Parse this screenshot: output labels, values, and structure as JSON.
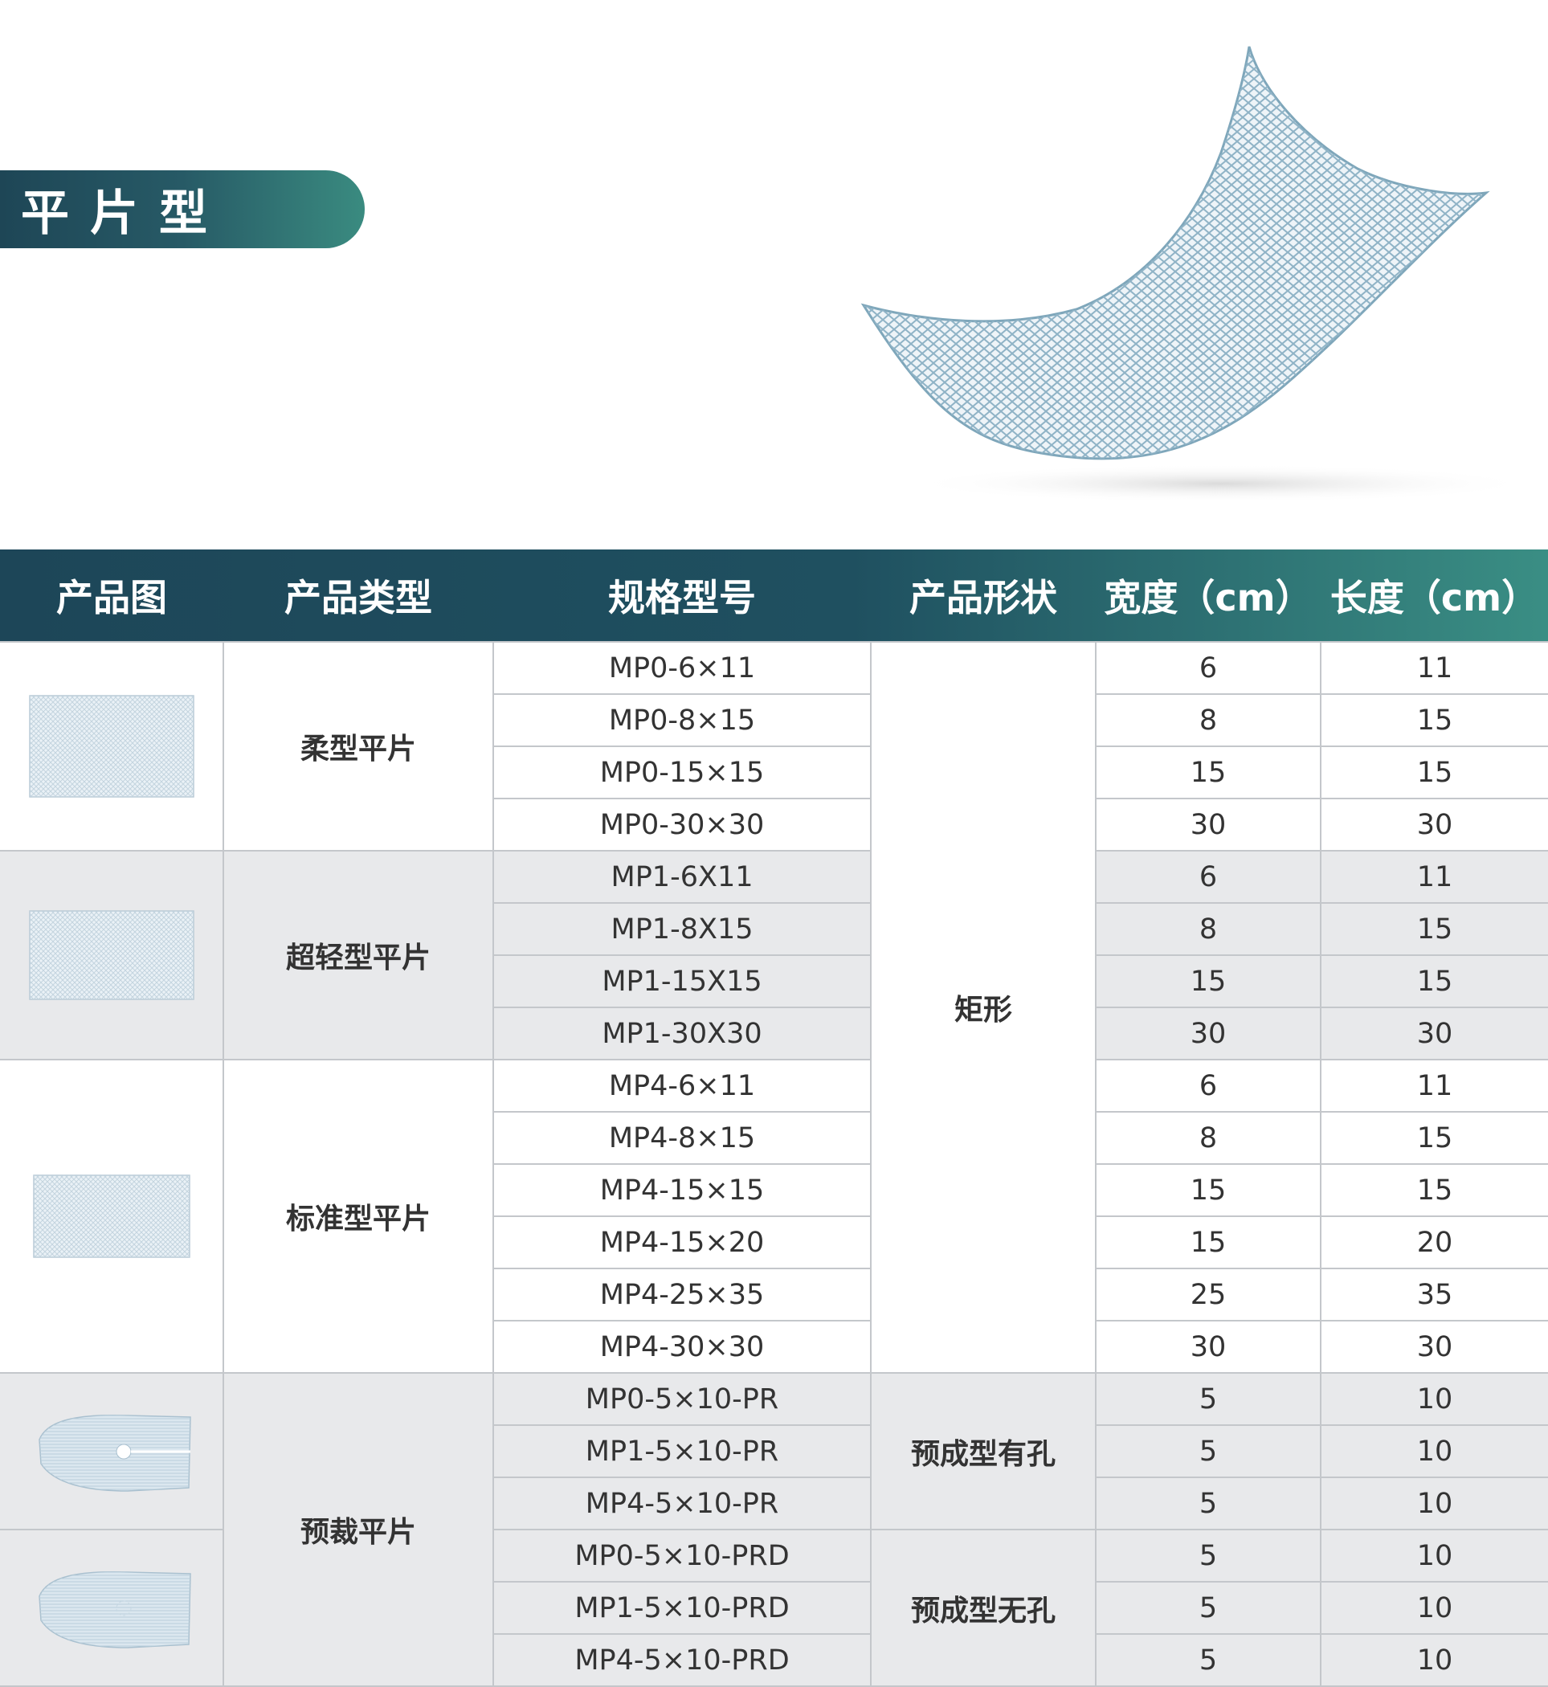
{
  "section": {
    "title": "平片型"
  },
  "icons": {
    "hero": "mesh-sheet-illustration"
  },
  "colors": {
    "header_dark": "#1d4658",
    "header_light": "#3a8e84",
    "row_grey": "#e8e9eb"
  },
  "table": {
    "headers": [
      "产品图",
      "产品类型",
      "规格型号",
      "产品形状",
      "宽度（cm）",
      "长度（cm）"
    ],
    "groups": [
      {
        "type": "柔型平片",
        "image": "rectangular-mesh-thumb",
        "rows": [
          {
            "model": "MP0-6×11",
            "width": "6",
            "length": "11"
          },
          {
            "model": "MP0-8×15",
            "width": "8",
            "length": "15"
          },
          {
            "model": "MP0-15×15",
            "width": "15",
            "length": "15"
          },
          {
            "model": "MP0-30×30",
            "width": "30",
            "length": "30"
          }
        ]
      },
      {
        "type": "超轻型平片",
        "image": "rectangular-mesh-thumb",
        "rows": [
          {
            "model": "MP1-6X11",
            "width": "6",
            "length": "11"
          },
          {
            "model": "MP1-8X15",
            "width": "8",
            "length": "15"
          },
          {
            "model": "MP1-15X15",
            "width": "15",
            "length": "15"
          },
          {
            "model": "MP1-30X30",
            "width": "30",
            "length": "30"
          }
        ]
      },
      {
        "type": "标准型平片",
        "image": "rectangular-mesh-thumb",
        "rows": [
          {
            "model": "MP4-6×11",
            "width": "6",
            "length": "11"
          },
          {
            "model": "MP4-8×15",
            "width": "8",
            "length": "15"
          },
          {
            "model": "MP4-15×15",
            "width": "15",
            "length": "15"
          },
          {
            "model": "MP4-15×20",
            "width": "15",
            "length": "20"
          },
          {
            "model": "MP4-25×35",
            "width": "25",
            "length": "35"
          },
          {
            "model": "MP4-30×30",
            "width": "30",
            "length": "30"
          }
        ]
      },
      {
        "type": "预裁平片",
        "image": "precut-mesh-thumb",
        "rows": [
          {
            "model": "MP0-5×10-PR",
            "width": "5",
            "length": "10"
          },
          {
            "model": "MP1-5×10-PR",
            "width": "5",
            "length": "10"
          },
          {
            "model": "MP4-5×10-PR",
            "width": "5",
            "length": "10"
          },
          {
            "model": "MP0-5×10-PRD",
            "width": "5",
            "length": "10"
          },
          {
            "model": "MP1-5×10-PRD",
            "width": "5",
            "length": "10"
          },
          {
            "model": "MP4-5×10-PRD",
            "width": "5",
            "length": "10"
          }
        ]
      }
    ],
    "shapes": {
      "rect": "矩形",
      "with_hole": "预成型有孔",
      "no_hole": "预成型无孔"
    }
  }
}
